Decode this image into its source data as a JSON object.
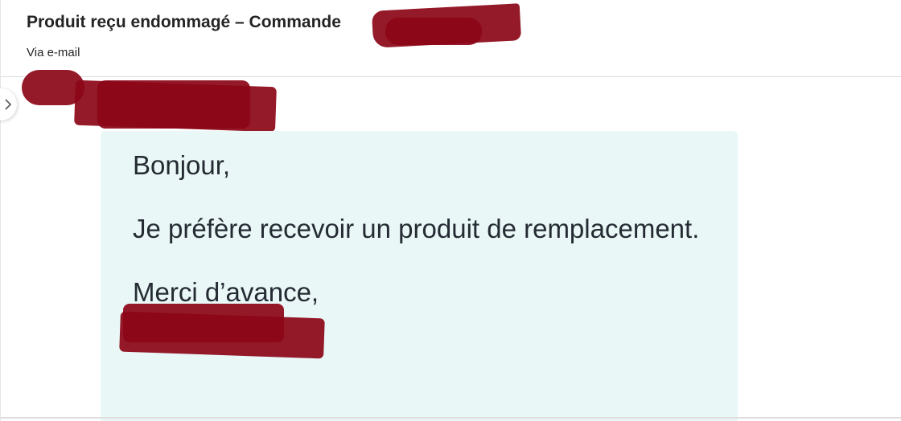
{
  "ticket": {
    "title": "Produit reçu endommagé – Commande",
    "channel": "Via e-mail"
  },
  "message": {
    "greeting": "Bonjour,",
    "body": "Je préfère recevoir un produit de remplacement.",
    "closing": "Merci d’avance,"
  },
  "icons": {
    "expand": "chevron-right-icon"
  },
  "colors": {
    "bubble_background": "#eaf7f7",
    "redaction": "#8b0517",
    "text": "#242424"
  }
}
